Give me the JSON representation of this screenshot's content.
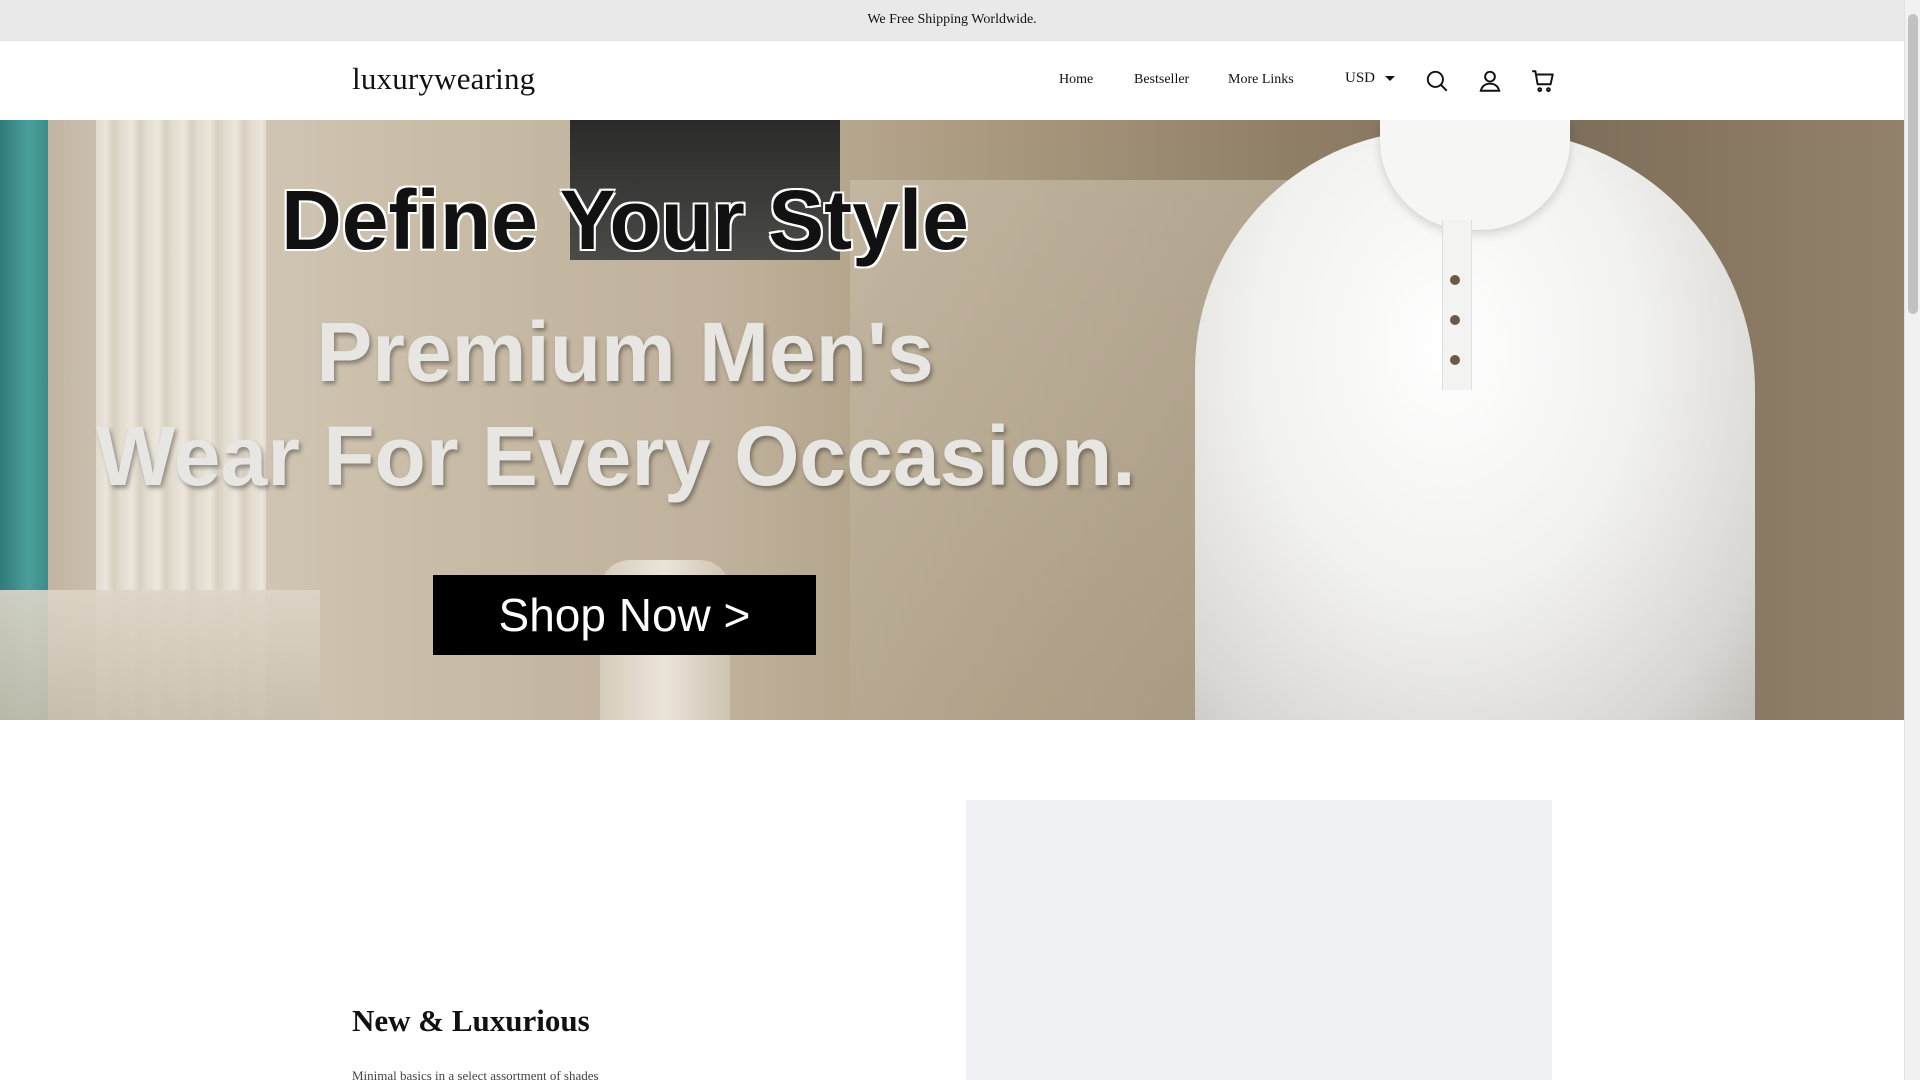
{
  "announcement": {
    "text": "We Free Shipping Worldwide."
  },
  "header": {
    "logo": "luxurywearing",
    "nav": [
      "Home",
      "Bestseller",
      "More Links"
    ],
    "currency": "USD",
    "icons": [
      "search-icon",
      "account-icon",
      "cart-icon"
    ]
  },
  "hero": {
    "headline": "Define Your Style",
    "subline_1": "Premium Men's",
    "subline_2": "Wear For Every Occasion.",
    "cta": "Shop Now >"
  },
  "feature": {
    "title": "New & Luxurious",
    "subtitle": "Minimal basics in a select assortment of shades"
  },
  "colors": {
    "announcement_bg": "#e9e9e9",
    "header_bg": "#ffffff",
    "cta_bg": "#000000",
    "feature_image_bg": "#f0f1f5"
  }
}
